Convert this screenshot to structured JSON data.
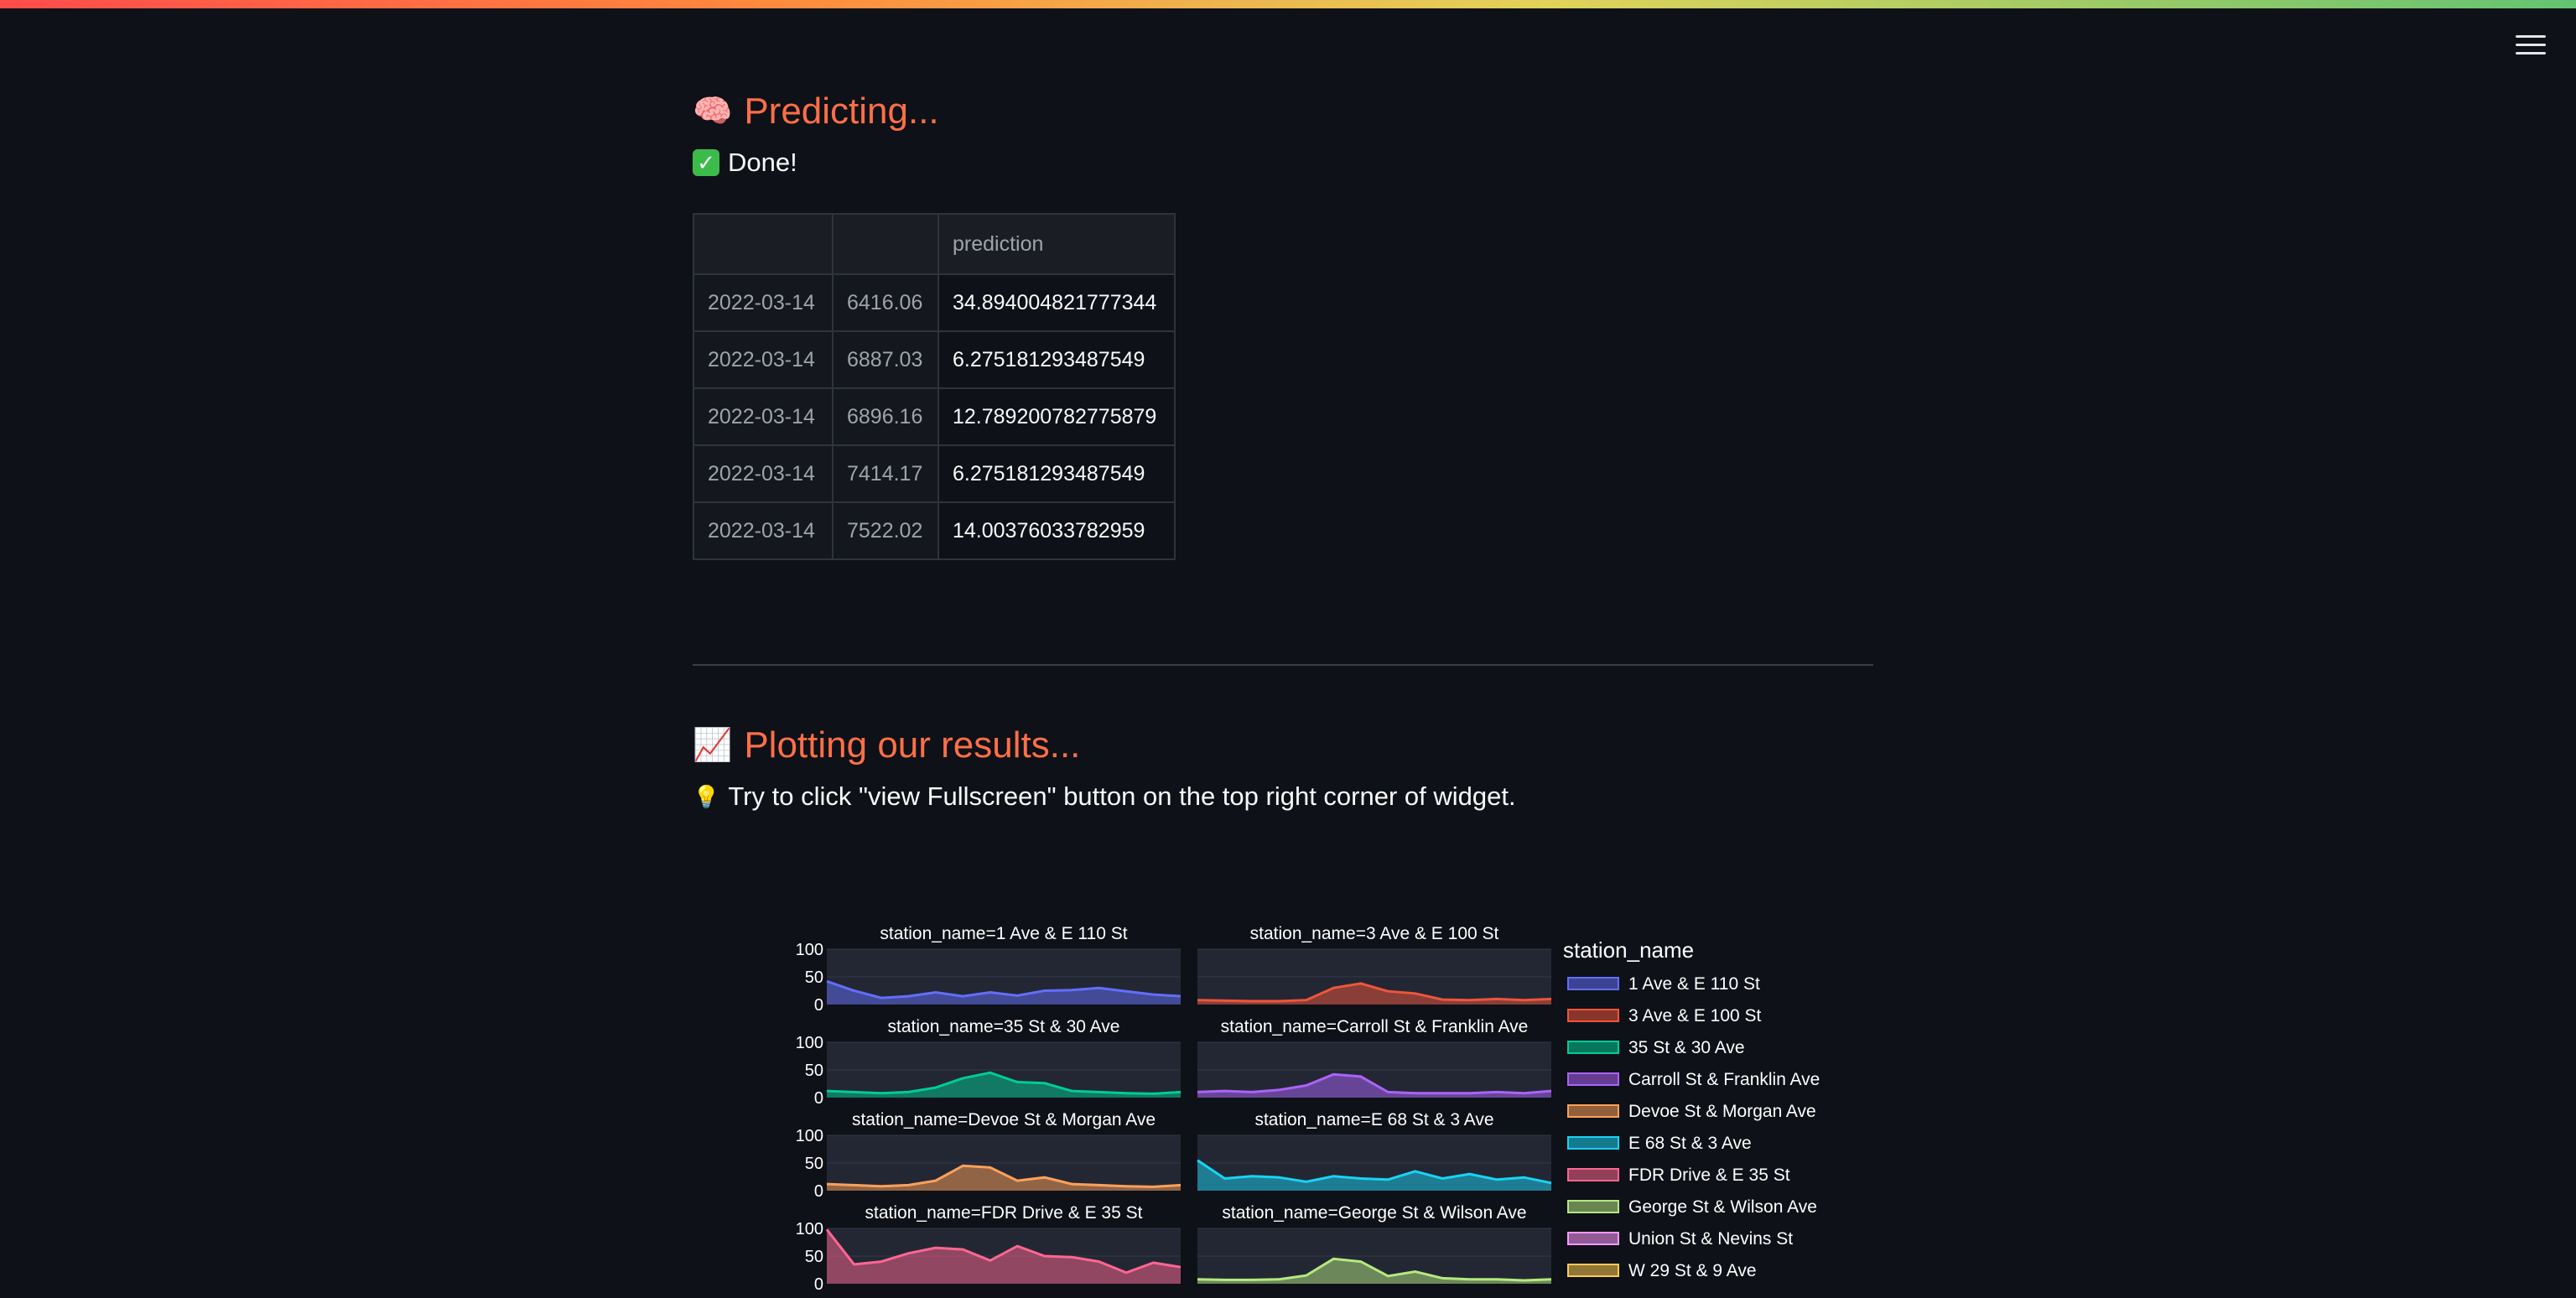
{
  "sections": {
    "predicting_title": "Predicting...",
    "done_text": "Done!",
    "plotting_title": "Plotting our results...",
    "tip_text": "Try to click \"view Fullscreen\" button on the top right corner of widget."
  },
  "table": {
    "headers": [
      "",
      "",
      "prediction"
    ],
    "rows": [
      [
        "2022-03-14",
        "6416.06",
        "34.894004821777344"
      ],
      [
        "2022-03-14",
        "6887.03",
        "6.275181293487549"
      ],
      [
        "2022-03-14",
        "6896.16",
        "12.789200782775879"
      ],
      [
        "2022-03-14",
        "7414.17",
        "6.275181293487549"
      ],
      [
        "2022-03-14",
        "7522.02",
        "14.00376033782959"
      ]
    ]
  },
  "icons": {
    "menu": "hamburger-menu-icon",
    "predicting": "brain-icon",
    "done": "check-mark-icon",
    "plotting": "chart-increasing-icon",
    "tip": "light-bulb-icon"
  },
  "chart_data": {
    "type": "area",
    "legend_title": "station_name",
    "yticks": [
      0,
      50,
      100
    ],
    "ylim": [
      0,
      100
    ],
    "panels": [
      {
        "title": "station_name=1 Ave & E 110 St",
        "series": "1 Ave & E 110 St",
        "color": "#636efa",
        "values": [
          42,
          25,
          12,
          15,
          22,
          15,
          22,
          16,
          25,
          26,
          30,
          24,
          18,
          15
        ]
      },
      {
        "title": "station_name=3 Ave & E 100 St",
        "series": "3 Ave & E 100 St",
        "color": "#ef553b",
        "values": [
          8,
          7,
          6,
          6,
          8,
          30,
          38,
          24,
          20,
          9,
          8,
          10,
          8,
          10
        ]
      },
      {
        "title": "station_name=35 St & 30 Ave",
        "series": "35 St & 30 Ave",
        "color": "#00cc96",
        "values": [
          12,
          10,
          8,
          10,
          18,
          35,
          45,
          28,
          26,
          12,
          10,
          8,
          7,
          10
        ]
      },
      {
        "title": "station_name=Carroll St & Franklin Ave",
        "series": "Carroll St & Franklin Ave",
        "color": "#ab63fa",
        "values": [
          10,
          12,
          10,
          14,
          22,
          42,
          38,
          10,
          8,
          8,
          8,
          10,
          8,
          12
        ]
      },
      {
        "title": "station_name=Devoe St & Morgan Ave",
        "series": "Devoe St & Morgan Ave",
        "color": "#ffa15a",
        "values": [
          12,
          10,
          8,
          10,
          18,
          45,
          42,
          18,
          24,
          12,
          10,
          8,
          7,
          10
        ]
      },
      {
        "title": "station_name=E 68 St & 3 Ave",
        "series": "E 68 St & 3 Ave",
        "color": "#19d3f3",
        "values": [
          55,
          22,
          26,
          24,
          16,
          26,
          22,
          20,
          35,
          22,
          30,
          20,
          24,
          14
        ]
      },
      {
        "title": "station_name=FDR Drive & E 35 St",
        "series": "FDR Drive & E 35 St",
        "color": "#ff6692",
        "values": [
          98,
          35,
          40,
          55,
          65,
          62,
          42,
          68,
          50,
          48,
          40,
          20,
          38,
          30
        ]
      },
      {
        "title": "station_name=George St & Wilson Ave",
        "series": "George St & Wilson Ave",
        "color": "#b6e880",
        "values": [
          8,
          7,
          7,
          8,
          15,
          45,
          40,
          14,
          22,
          10,
          8,
          8,
          6,
          8
        ]
      }
    ],
    "legend": [
      {
        "name": "1 Ave & E 110 St",
        "color": "#636efa"
      },
      {
        "name": "3 Ave & E 100 St",
        "color": "#ef553b"
      },
      {
        "name": "35 St & 30 Ave",
        "color": "#00cc96"
      },
      {
        "name": "Carroll St & Franklin Ave",
        "color": "#ab63fa"
      },
      {
        "name": "Devoe St & Morgan Ave",
        "color": "#ffa15a"
      },
      {
        "name": "E 68 St & 3 Ave",
        "color": "#19d3f3"
      },
      {
        "name": "FDR Drive & E 35 St",
        "color": "#ff6692"
      },
      {
        "name": "George St & Wilson Ave",
        "color": "#b6e880"
      },
      {
        "name": "Union St & Nevins St",
        "color": "#ff97ff"
      },
      {
        "name": "W 29 St & 9 Ave",
        "color": "#fecb52"
      }
    ]
  }
}
